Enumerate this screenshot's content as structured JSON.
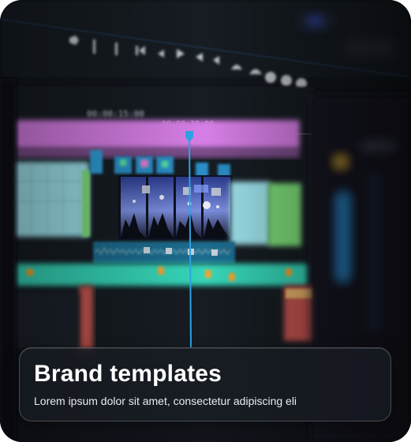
{
  "card": {
    "title": "Brand templates",
    "description": "Lorem ipsum dolor sit amet, consectetur adipiscing eli"
  },
  "editor": {
    "timecodes": [
      "00:00:15:00",
      "00:00:30:00"
    ],
    "colors": {
      "background": "#0c0f16",
      "magenta_track": "#d77ee6",
      "cyan_clip": "#9fe4ee",
      "green_clip": "#7fe07a",
      "teal_audio": "#36d6b9",
      "playhead": "#2da6e8"
    },
    "toolbar_icons": [
      "marker-icon",
      "split-icon",
      "step-back-icon",
      "play-icon",
      "step-forward-icon",
      "volume-icon",
      "cloud-icon",
      "camera-icon"
    ]
  }
}
